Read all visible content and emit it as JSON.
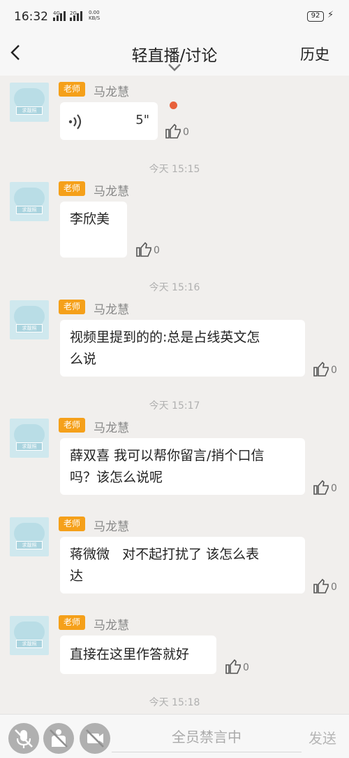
{
  "status_bar": {
    "time": "16:32",
    "network_1": "4G",
    "network_2": "2G",
    "speed_value": "0.00",
    "speed_unit": "KB/S",
    "battery": "92"
  },
  "header": {
    "back_icon": "chevron-left-icon",
    "title": "轻直播/讨论",
    "dropdown_icon": "chevron-down-icon",
    "history_label": "历史"
  },
  "messages": [
    {
      "badge": "老师",
      "sender": "马龙慧",
      "type": "voice",
      "duration": "5\"",
      "likes": "0",
      "unread": true
    },
    {
      "timestamp": "今天 15:15"
    },
    {
      "badge": "老师",
      "sender": "马龙慧",
      "type": "text",
      "text": "李欣美",
      "likes": "0"
    },
    {
      "timestamp": "今天 15:16"
    },
    {
      "badge": "老师",
      "sender": "马龙慧",
      "type": "text",
      "line1": "视频里提到的的:总是占线英文怎",
      "line2": "么说",
      "likes": "0"
    },
    {
      "timestamp": "今天 15:17"
    },
    {
      "badge": "老师",
      "sender": "马龙慧",
      "type": "text",
      "line1": "薛双喜 我可以帮你留言/捎个口信",
      "line2": "吗？该怎么说呢",
      "likes": "0"
    },
    {
      "badge": "老师",
      "sender": "马龙慧",
      "type": "text",
      "line1": "蒋微微   对不起打扰了 该怎么表",
      "line2": "达",
      "likes": "0"
    },
    {
      "badge": "老师",
      "sender": "马龙慧",
      "type": "text",
      "text": "直接在这里作答就好",
      "likes": "0"
    },
    {
      "timestamp": "今天 15:18"
    }
  ],
  "avatar": {
    "tag": "求靓照"
  },
  "bottom_bar": {
    "mic_icon": "mic-off-icon",
    "hand_icon": "hand-raise-off-icon",
    "video_icon": "video-off-icon",
    "input_placeholder": "全员禁言中",
    "send_label": "发送"
  },
  "colors": {
    "badge": "#f5a01a",
    "unread_dot": "#e8613b",
    "background": "#f1efed"
  }
}
